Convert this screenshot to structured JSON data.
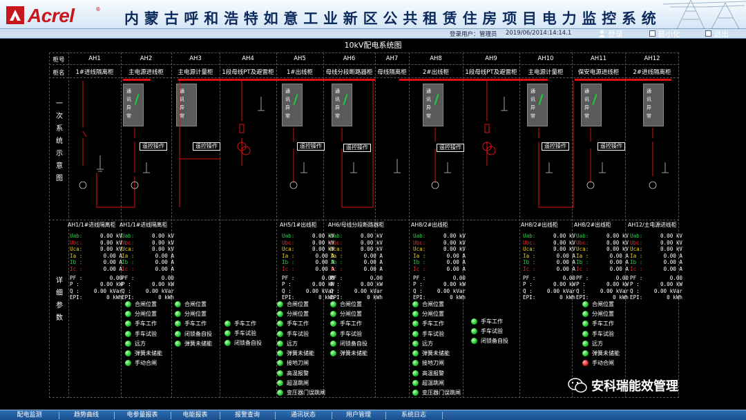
{
  "header": {
    "logo_text": "Acrel",
    "logo_reg": "®",
    "title": "内蒙古呼和浩特如意工业新区公共租赁住房项目电力监控系统"
  },
  "userbar": {
    "login_user_label": "登录用户：",
    "user": "管理员",
    "date": "2019/06/20",
    "time": "14:14:14.1",
    "login_btn": "登录",
    "minimize_btn": "最小化",
    "exit_btn": "退出"
  },
  "diagram_title": "10kV配电系统图",
  "row_labels": {
    "cabinet_no": "柜号",
    "cabinet_name": "柜名",
    "primary": [
      "一",
      "次",
      "系",
      "统",
      "示",
      "意",
      "图"
    ],
    "detail": [
      "详",
      "细",
      "参",
      "数"
    ]
  },
  "cabinets": [
    {
      "no": "AH1",
      "name": "1#进线隔离柜"
    },
    {
      "no": "AH2",
      "name": "主电源进线柜"
    },
    {
      "no": "AH3",
      "name": "主电源计量柜"
    },
    {
      "no": "AH4",
      "name": "1段母线PT及避雷柜"
    },
    {
      "no": "AH5",
      "name": "1#出线柜"
    },
    {
      "no": "AH6",
      "name": "母线分段断路器柜"
    },
    {
      "no": "AH7",
      "name": "母线隔离柜"
    },
    {
      "no": "AH8",
      "name": "2#出线柜"
    },
    {
      "no": "AH9",
      "name": "1段母线PT及避雷柜"
    },
    {
      "no": "AH10",
      "name": "主电源计量柜"
    },
    {
      "no": "AH11",
      "name": "保安电源进线柜"
    },
    {
      "no": "AH12",
      "name": "2#进线隔离柜"
    }
  ],
  "gray_box_text": [
    "通",
    "讯",
    "异",
    "常"
  ],
  "remote_op": "遥控操作",
  "detail_panels": [
    {
      "title": "AH1/1#进线隔离柜"
    },
    {
      "title": "AH1/1#进线隔离柜"
    },
    {
      "title": "AH5/1#出线柜"
    },
    {
      "title": "AH6/母线分段断路器柜"
    },
    {
      "title": "AH8/2#出线柜"
    },
    {
      "title": "AH8/2#出线柜"
    },
    {
      "title": "AH8/2#出线柜"
    },
    {
      "title": "AH12/主电源进线柜"
    }
  ],
  "measure_labels": [
    "Uab:",
    "Ubc:",
    "Uca:",
    "Ia :",
    "Ib :",
    "Ic :",
    "PF :",
    "P  :",
    "Q  :",
    "EPI:"
  ],
  "measure_values": [
    "0.00 kV",
    "0.00 kV",
    "0.00 kV",
    "0.00  A",
    "0.00  A",
    "0.00  A",
    "0.00",
    "0.00 kW",
    "0.00 kVar",
    "0 kWh"
  ],
  "status": {
    "ah2": [
      "合闸位置",
      "分闸位置",
      "手车工作",
      "手车试验",
      "远方",
      "弹簧未储能",
      "手动合闸"
    ],
    "ah3": [
      "合闸位置",
      "分闸位置",
      "手车工作",
      "闭锁备自投",
      "弹簧未储能"
    ],
    "ah4": [
      "手车工作",
      "手车试验",
      "闭锁备自投"
    ],
    "ah5": [
      "合闸位置",
      "分闸位置",
      "手车工作",
      "手车试验",
      "远方",
      "弹簧未储能",
      "接地刀闸",
      "高温报警",
      "超温跳闸",
      "变压器门误跳闸"
    ],
    "ah6": [
      "合闸位置",
      "分闸位置",
      "手车工作",
      "手车试验",
      "闭锁备自投",
      "弹簧未储能"
    ],
    "ah8": [
      "合闸位置",
      "分闸位置",
      "手车工作",
      "手车试验",
      "远方",
      "弹簧未储能",
      "接地刀闸",
      "高温报警",
      "超温跳闸",
      "变压器门误跳闸"
    ],
    "ah9": [
      "手车工作",
      "手车试验",
      "闭锁备自投"
    ],
    "ah11": [
      "合闸位置",
      "分闸位置",
      "手车工作",
      "手车试验",
      "远方",
      "弹簧未储能",
      "手动合闸"
    ]
  },
  "watermark": "安科瑞能效管理",
  "footer": [
    "配电监测",
    "趋势曲线",
    "电参量报表",
    "电能报表",
    "报警查询",
    "通讯状态",
    "用户管理",
    "系统日志"
  ],
  "colors": {
    "bus": "#e01010",
    "led_on": "#18c028",
    "led_alarm": "#e01818",
    "footer": "#1a4e8c"
  }
}
